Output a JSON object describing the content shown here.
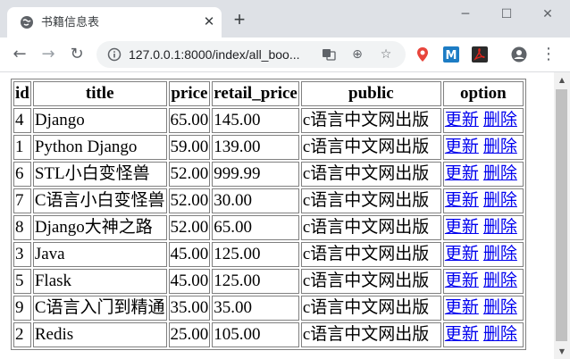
{
  "browser": {
    "tab_title": "书籍信息表",
    "url": "127.0.0.1:8000/index/all_boo...",
    "colors": {
      "tabstrip": "#dee1e6",
      "link": "#0000ee"
    }
  },
  "table": {
    "headers": [
      "id",
      "title",
      "price",
      "retail_price",
      "public",
      "option"
    ],
    "rows": [
      {
        "id": "4",
        "title": "Django",
        "price": "65.00",
        "retail_price": "145.00",
        "public": "c语言中文网出版"
      },
      {
        "id": "1",
        "title": "Python Django",
        "price": "59.00",
        "retail_price": "139.00",
        "public": "c语言中文网出版"
      },
      {
        "id": "6",
        "title": "STL小白变怪兽",
        "price": "52.00",
        "retail_price": "999.99",
        "public": "c语言中文网出版"
      },
      {
        "id": "7",
        "title": "C语言小白变怪兽",
        "price": "52.00",
        "retail_price": "30.00",
        "public": "c语言中文网出版"
      },
      {
        "id": "8",
        "title": "Django大神之路",
        "price": "52.00",
        "retail_price": "65.00",
        "public": "c语言中文网出版"
      },
      {
        "id": "3",
        "title": "Java",
        "price": "45.00",
        "retail_price": "125.00",
        "public": "c语言中文网出版"
      },
      {
        "id": "5",
        "title": "Flask",
        "price": "45.00",
        "retail_price": "125.00",
        "public": "c语言中文网出版"
      },
      {
        "id": "9",
        "title": "C语言入门到精通",
        "price": "35.00",
        "retail_price": "35.00",
        "public": "c语言中文网出版"
      },
      {
        "id": "2",
        "title": "Redis",
        "price": "25.00",
        "retail_price": "105.00",
        "public": "c语言中文网出版"
      }
    ],
    "option_links": {
      "update": "更新",
      "delete": "删除"
    }
  }
}
